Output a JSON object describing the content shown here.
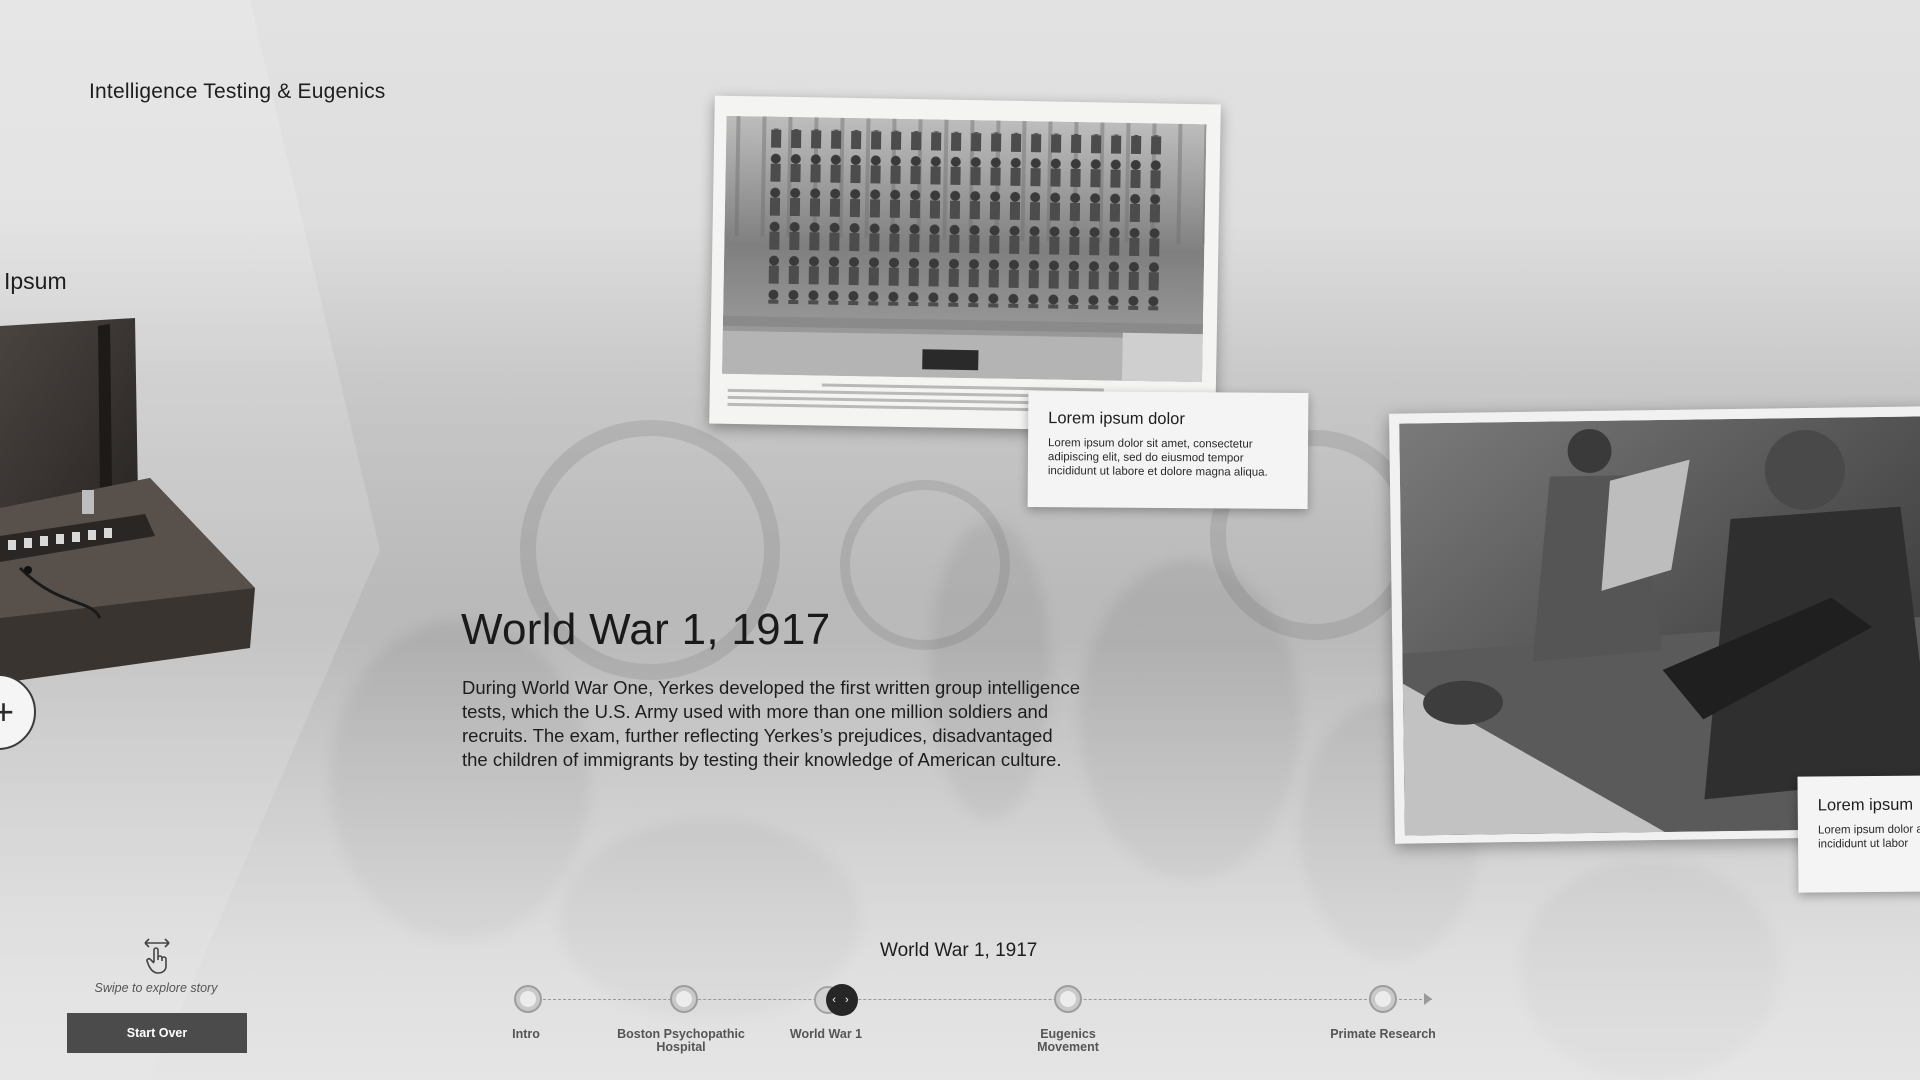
{
  "header": {
    "section_title": "Intelligence Testing & Eugenics"
  },
  "previous_card": {
    "heading_fragment": "Ipsum",
    "expand_icon": "plus-icon",
    "expand_label": "+"
  },
  "story": {
    "title": "World War 1, 1917",
    "body": "During World War One, Yerkes developed the first written group intelligence tests, which the U.S. Army used with more than one million soldiers and recruits. The exam, further reflecting Yerkes’s prejudices, disadvantaged the children of immigrants by testing their knowledge of American culture."
  },
  "photo_group": {
    "caption_title": "Lorem ipsum dolor",
    "caption_body": "Lorem ipsum dolor sit amet, consectetur adipiscing elit, sed do eiusmod tempor incididunt ut labore et dolore magna aliqua."
  },
  "photo_soldier": {
    "caption_title": "Lorem ipsum",
    "caption_body": "Lorem ipsum dolor adipiscing elit, sed incididunt ut labor"
  },
  "controls": {
    "swipe_icon": "swipe-hand-icon",
    "swipe_hint": "Swipe to explore story",
    "start_over_label": "Start Over"
  },
  "timeline": {
    "current_label": "World War 1, 1917",
    "active_icon": "left-right-chevrons-icon",
    "active_glyph": "‹ ›",
    "nodes": [
      {
        "label": "Intro"
      },
      {
        "label": "Boston Psychopathic Hospital"
      },
      {
        "label": "World War 1"
      },
      {
        "label": "Eugenics Movement"
      },
      {
        "label": "Primate Research"
      }
    ],
    "active_index": 2
  }
}
